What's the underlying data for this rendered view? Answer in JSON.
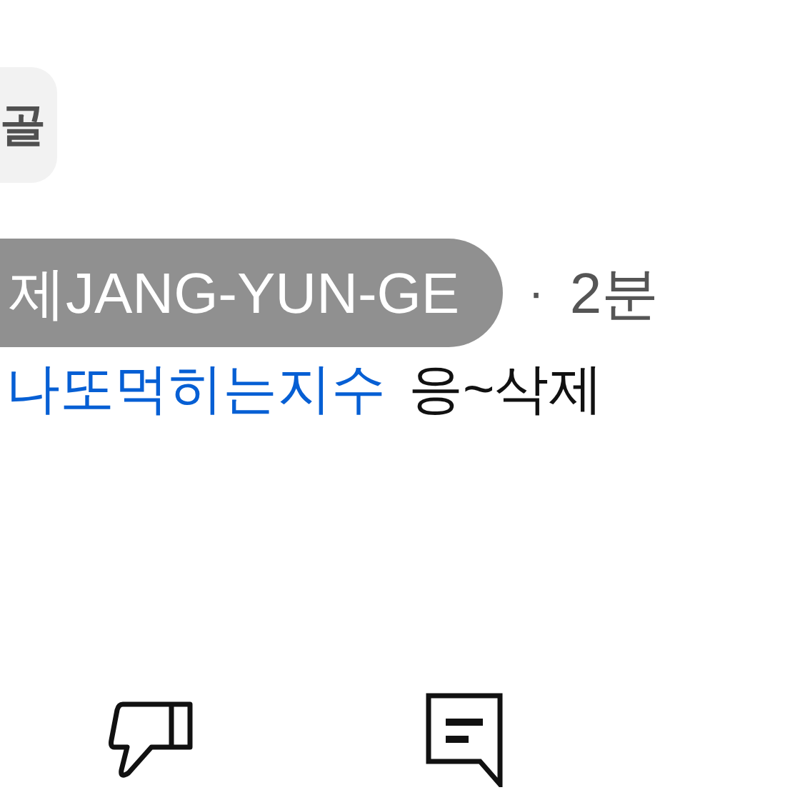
{
  "top_chip": {
    "label": "골"
  },
  "comment": {
    "author": "제JANG-YUN-GE",
    "separator": "·",
    "time": "2분",
    "mention": "나또먹히는지수",
    "text": "응~삭제"
  },
  "actions": [
    {
      "kind": "dislike"
    },
    {
      "kind": "reply"
    }
  ]
}
